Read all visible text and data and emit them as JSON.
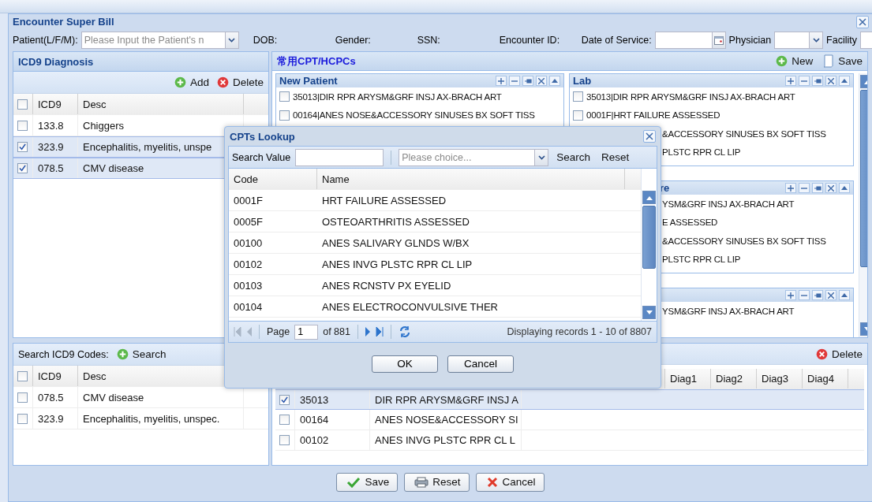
{
  "window": {
    "title": "Encounter Super Bill"
  },
  "patient_bar": [
    {
      "kind": "combo",
      "label": "Patient(L/F/M):",
      "placeholder": "Please Input the Patient's n"
    },
    {
      "kind": "label",
      "label": "DOB:"
    },
    {
      "kind": "label",
      "label": "Gender:"
    },
    {
      "kind": "label",
      "label": "SSN:"
    },
    {
      "kind": "label",
      "label": "Encounter ID:"
    },
    {
      "kind": "date",
      "label": "Date of Service:"
    },
    {
      "kind": "select",
      "label": "Physician"
    },
    {
      "kind": "select",
      "label": "Facility"
    }
  ],
  "diagnosis": {
    "title": "ICD9 Diagnosis",
    "all_checked": false,
    "actions": [
      {
        "kind": "add",
        "label": "Add"
      },
      {
        "kind": "delete",
        "label": "Delete"
      }
    ],
    "columns": [
      "ICD9",
      "Desc"
    ],
    "rows": [
      {
        "code": "133.8",
        "desc": "Chiggers",
        "checked": false,
        "selected": false
      },
      {
        "code": "323.9",
        "desc": "Encephalitis, myelitis, unspe",
        "checked": true,
        "selected": true
      },
      {
        "code": "078.5",
        "desc": "CMV disease",
        "checked": true,
        "selected": true
      }
    ]
  },
  "icd_search": {
    "label": "Search ICD9 Codes:",
    "all_checked": false,
    "actions": [
      {
        "kind": "add",
        "label": "Search"
      }
    ],
    "columns": [
      "ICD9",
      "Desc"
    ],
    "rows": [
      {
        "code": "078.5",
        "desc": "CMV disease",
        "checked": false
      },
      {
        "code": "323.9",
        "desc": "Encephalitis, myelitis, unspec.",
        "checked": false
      }
    ]
  },
  "cpt": {
    "title": "常用CPT/HCPCs",
    "actions": [
      {
        "kind": "add",
        "label": "New"
      },
      {
        "kind": "save",
        "label": "Save"
      }
    ],
    "columns": [
      {
        "panels": [
          {
            "kind": "full",
            "title": "New Patient",
            "items": [
              {
                "kind": "full",
                "label": "35013|DIR RPR ARYSM&GRF INSJ AX-BRACH ART",
                "checked": false
              },
              {
                "kind": "full",
                "label": "00164|ANES NOSE&ACCESSORY SINUSES BX SOFT TISS",
                "checked": false
              }
            ]
          }
        ]
      },
      {
        "panels": [
          {
            "kind": "full",
            "title": "Lab",
            "items": [
              {
                "kind": "full",
                "label": "35013|DIR RPR ARYSM&GRF INSJ AX-BRACH ART",
                "checked": false
              },
              {
                "kind": "full",
                "label": "0001F|HRT FAILURE ASSESSED",
                "checked": false
              },
              {
                "kind": "partial",
                "label": "&ACCESSORY SINUSES BX SOFT TISS"
              },
              {
                "kind": "partial",
                "label": "PLSTC RPR CL LIP"
              }
            ]
          },
          {
            "kind": "partial",
            "title": "re",
            "items": [
              {
                "kind": "partial",
                "label": "YSM&GRF INSJ AX-BRACH ART"
              },
              {
                "kind": "partial",
                "label": "E ASSESSED"
              },
              {
                "kind": "partial",
                "label": "&ACCESSORY SINUSES BX SOFT TISS"
              },
              {
                "kind": "partial",
                "label": "PLSTC RPR CL LIP"
              }
            ]
          },
          {
            "kind": "partial",
            "items": [
              {
                "kind": "partial",
                "label": "YSM&GRF INSJ AX-BRACH ART"
              }
            ]
          }
        ]
      }
    ]
  },
  "procedures": {
    "actions": [
      {
        "kind": "delete",
        "label": "Delete"
      }
    ],
    "columns": [
      "Diag1",
      "Diag2",
      "Diag3",
      "Diag4"
    ],
    "rows": [
      {
        "proc": "35013",
        "desc": "DIR RPR ARYSM&GRF INSJ A",
        "checked": true,
        "selected": true
      },
      {
        "proc": "00164",
        "desc": "ANES NOSE&ACCESSORY SI",
        "checked": false,
        "selected": false
      },
      {
        "proc": "00102",
        "desc": "ANES INVG PLSTC RPR CL L",
        "checked": false,
        "selected": false
      }
    ]
  },
  "footer": [
    {
      "kind": "save",
      "label": "Save"
    },
    {
      "kind": "reset",
      "label": "Reset"
    },
    {
      "kind": "cancel",
      "label": "Cancel"
    }
  ],
  "lookup": {
    "title": "CPTs Lookup",
    "search_label": "Search Value",
    "select_placeholder": "Please choice...",
    "actions": [
      "Search",
      "Reset"
    ],
    "columns": [
      "Code",
      "Name"
    ],
    "rows": [
      {
        "code": "0001F",
        "name": "HRT FAILURE ASSESSED"
      },
      {
        "code": "0005F",
        "name": "OSTEOARTHRITIS ASSESSED"
      },
      {
        "code": "00100",
        "name": "ANES SALIVARY GLNDS W/BX"
      },
      {
        "code": "00102",
        "name": "ANES INVG PLSTC RPR CL LIP"
      },
      {
        "code": "00103",
        "name": "ANES RCNSTV PX EYELID"
      },
      {
        "code": "00104",
        "name": "ANES ELECTROCONVULSIVE THER"
      }
    ],
    "paging": {
      "page_label": "Page",
      "page": "1",
      "of": "of 881",
      "status": "Displaying records 1 - 10 of 8807"
    },
    "buttons": [
      "OK",
      "Cancel"
    ]
  }
}
